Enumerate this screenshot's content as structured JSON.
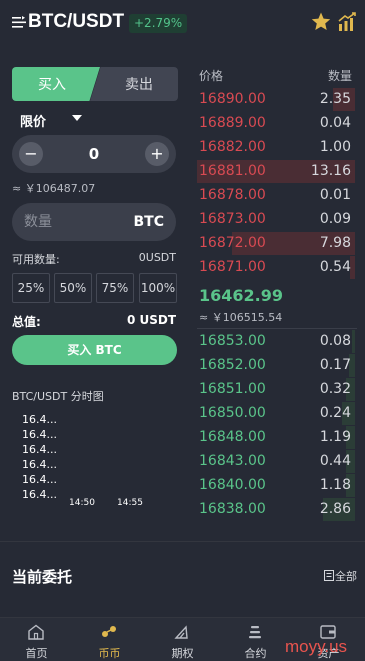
{
  "header": {
    "pair": "BTC/USDT",
    "change": "+2.79%"
  },
  "trade": {
    "buy_tab": "买入",
    "sell_tab": "卖出",
    "order_type": "限价",
    "price_value": "0",
    "approx_cny": "≈ ￥106487.07",
    "qty_placeholder": "数量",
    "qty_unit": "BTC",
    "available_label": "可用数量:",
    "available_value": "0USDT",
    "percents": [
      "25%",
      "50%",
      "75%",
      "100%"
    ],
    "total_label": "总值:",
    "total_value": "0 USDT",
    "buy_button": "买入 BTC",
    "minus": "−",
    "plus": "+"
  },
  "mini_chart": {
    "title": "BTC/USDT 分时图",
    "y_labels": [
      "16.4...",
      "16.4...",
      "16.4...",
      "16.4...",
      "16.4...",
      "16.4..."
    ],
    "x_labels": [
      "14:50",
      "14:55"
    ]
  },
  "orderbook": {
    "price_header": "价格",
    "qty_header": "数量",
    "asks": [
      {
        "price": "16890.00",
        "qty": "2.35",
        "depth": 0.14
      },
      {
        "price": "16889.00",
        "qty": "0.04",
        "depth": 0.0
      },
      {
        "price": "16882.00",
        "qty": "1.00",
        "depth": 0.0
      },
      {
        "price": "16881.00",
        "qty": "13.16",
        "depth": 1.0
      },
      {
        "price": "16878.00",
        "qty": "0.01",
        "depth": 0.0
      },
      {
        "price": "16873.00",
        "qty": "0.09",
        "depth": 0.0
      },
      {
        "price": "16872.00",
        "qty": "7.98",
        "depth": 0.78
      },
      {
        "price": "16871.00",
        "qty": "0.54",
        "depth": 0.03
      }
    ],
    "last_price": "16462.99",
    "last_price_cny": "≈ ￥106515.54",
    "bids": [
      {
        "price": "16853.00",
        "qty": "0.08",
        "depth": 0.02
      },
      {
        "price": "16852.00",
        "qty": "0.17",
        "depth": 0.04
      },
      {
        "price": "16851.00",
        "qty": "0.32",
        "depth": 0.06
      },
      {
        "price": "16850.00",
        "qty": "0.24",
        "depth": 0.08
      },
      {
        "price": "16848.00",
        "qty": "1.19",
        "depth": 0.06
      },
      {
        "price": "16843.00",
        "qty": "0.44",
        "depth": 0.06
      },
      {
        "price": "16840.00",
        "qty": "1.18",
        "depth": 0.06
      },
      {
        "price": "16838.00",
        "qty": "2.86",
        "depth": 0.2
      }
    ]
  },
  "orders": {
    "title": "当前委托",
    "all_label": "全部"
  },
  "nav": [
    {
      "label": "首页",
      "icon": "home-icon",
      "active": false
    },
    {
      "label": "币币",
      "icon": "coins-icon",
      "active": true
    },
    {
      "label": "期权",
      "icon": "options-icon",
      "active": false
    },
    {
      "label": "合约",
      "icon": "contract-icon",
      "active": false
    },
    {
      "label": "资产",
      "icon": "wallet-icon",
      "active": false
    }
  ],
  "watermark": "moyy.us",
  "colors": {
    "green": "#5ac48a",
    "red": "#d84a52",
    "gold": "#e0b84e",
    "bg": "#262a35"
  }
}
